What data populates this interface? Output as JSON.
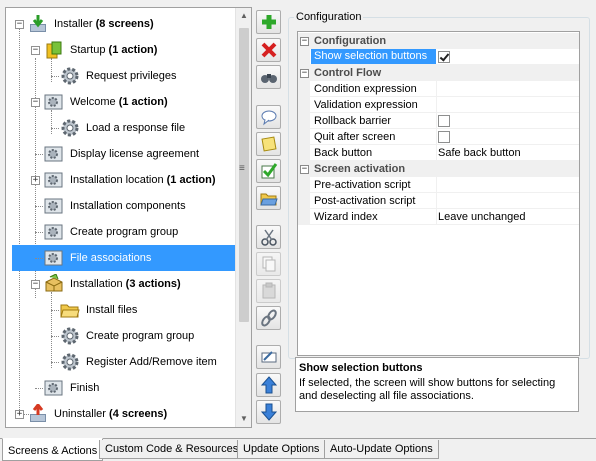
{
  "tree": {
    "nodes": [
      {
        "label": "Installer",
        "suffix": " (8 screens)"
      },
      {
        "label": "Startup",
        "suffix": " (1 action)"
      },
      {
        "label": "Request privileges",
        "suffix": ""
      },
      {
        "label": "Welcome",
        "suffix": " (1 action)"
      },
      {
        "label": "Load a response file",
        "suffix": ""
      },
      {
        "label": "Display license agreement",
        "suffix": ""
      },
      {
        "label": "Installation location",
        "suffix": " (1 action)"
      },
      {
        "label": "Installation components",
        "suffix": ""
      },
      {
        "label": "Create program group",
        "suffix": ""
      },
      {
        "label": "File associations",
        "suffix": ""
      },
      {
        "label": "Installation",
        "suffix": " (3 actions)"
      },
      {
        "label": "Install files",
        "suffix": ""
      },
      {
        "label": "Create program group",
        "suffix": ""
      },
      {
        "label": "Register Add/Remove item",
        "suffix": ""
      },
      {
        "label": "Finish",
        "suffix": ""
      },
      {
        "label": "Uninstaller",
        "suffix": " (4 screens)"
      }
    ],
    "selected": "File associations"
  },
  "toolbar": {
    "buttons": [
      "add-icon",
      "delete-icon",
      "find-icon",
      "comment-icon",
      "note-icon",
      "check-icon",
      "folder-icon",
      "cut-icon",
      "copy-icon",
      "paste-icon",
      "link-icon",
      "rename-icon",
      "move-up-icon",
      "move-down-icon"
    ]
  },
  "config": {
    "legend": "Configuration",
    "categories": {
      "configuration": "Configuration",
      "control_flow": "Control Flow",
      "screen_activation": "Screen activation"
    },
    "props": {
      "show_selection_buttons": "Show selection buttons",
      "condition_expression": "Condition expression",
      "validation_expression": "Validation expression",
      "rollback_barrier": "Rollback barrier",
      "quit_after_screen": "Quit after screen",
      "back_button": "Back button",
      "back_button_value": "Safe back button",
      "pre_activation_script": "Pre-activation script",
      "post_activation_script": "Post-activation script",
      "wizard_index": "Wizard index",
      "wizard_index_value": "Leave unchanged"
    },
    "checkbox_states": {
      "show_selection_buttons": true,
      "rollback_barrier": false,
      "quit_after_screen": false
    },
    "description": {
      "title": "Show selection buttons",
      "text": "If selected, the screen will show buttons for selecting and deselecting all file associations."
    }
  },
  "tabs": [
    "Screens & Actions",
    "Custom Code & Resources",
    "Update Options",
    "Auto-Update Options"
  ],
  "active_tab": "Screens & Actions"
}
